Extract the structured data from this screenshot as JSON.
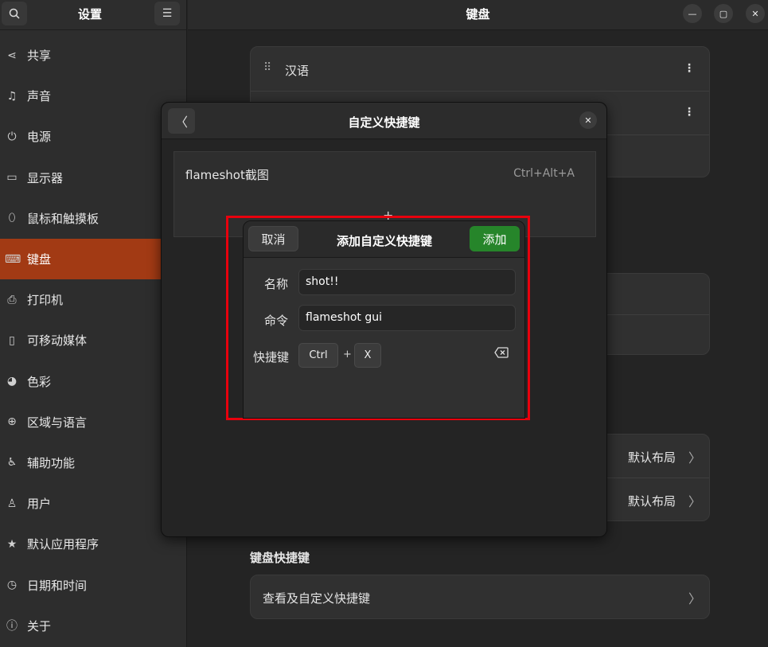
{
  "sidebar": {
    "title": "设置",
    "search_icon": "search-icon",
    "menu_icon": "hamburger-menu-icon",
    "items": [
      {
        "label": "共享",
        "icon": "share-icon"
      },
      {
        "label": "声音",
        "icon": "music-note-icon"
      },
      {
        "label": "电源",
        "icon": "power-icon"
      },
      {
        "label": "显示器",
        "icon": "display-icon"
      },
      {
        "label": "鼠标和触摸板",
        "icon": "mouse-icon"
      },
      {
        "label": "键盘",
        "icon": "keyboard-icon",
        "active": true
      },
      {
        "label": "打印机",
        "icon": "printer-icon"
      },
      {
        "label": "可移动媒体",
        "icon": "removable-media-icon"
      },
      {
        "label": "色彩",
        "icon": "color-icon"
      },
      {
        "label": "区域与语言",
        "icon": "globe-icon"
      },
      {
        "label": "辅助功能",
        "icon": "accessibility-icon"
      },
      {
        "label": "用户",
        "icon": "user-icon"
      },
      {
        "label": "默认应用程序",
        "icon": "star-icon"
      },
      {
        "label": "日期和时间",
        "icon": "clock-icon"
      },
      {
        "label": "关于",
        "icon": "info-icon"
      }
    ]
  },
  "main": {
    "title": "键盘",
    "input_sources": [
      {
        "label": "汉语"
      }
    ],
    "layout_rows": [
      {
        "value": "默认布局"
      },
      {
        "value": "默认布局"
      }
    ],
    "shortcuts_section_title": "键盘快捷键",
    "shortcuts_row_label": "查看及自定义快捷键"
  },
  "custom_shortcuts_dialog": {
    "title": "自定义快捷键",
    "shortcuts": [
      {
        "name": "flameshot截图",
        "accel": "Ctrl+Alt+A"
      }
    ],
    "add_symbol": "+"
  },
  "add_dialog": {
    "cancel_label": "取消",
    "title": "添加自定义快捷键",
    "add_label": "添加",
    "name_label": "名称",
    "name_value": "shot!!",
    "command_label": "命令",
    "command_value": "flameshot gui",
    "shortcut_label": "快捷键",
    "keys": [
      "Ctrl",
      "X"
    ],
    "key_separator": "+",
    "accent_color": "#26852a",
    "highlight_color": "#e8000d"
  }
}
